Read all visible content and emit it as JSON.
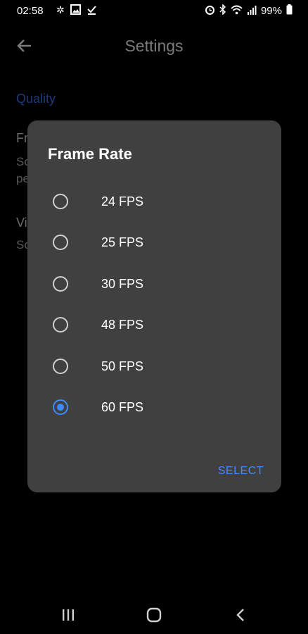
{
  "status_bar": {
    "time": "02:58",
    "left_icons": [
      "pinwheel-icon",
      "image-icon",
      "download-done-icon"
    ],
    "right_icons": [
      "alarm-icon",
      "bluetooth-icon",
      "wifi-icon",
      "signal-icon"
    ],
    "battery": "99%"
  },
  "app_bar": {
    "title": "Settings",
    "back_icon": "arrow-left-icon"
  },
  "background": {
    "section_header": "Quality",
    "item1_title": "Fr",
    "item1_sub_line1": "So",
    "item1_sub_line2": "pe",
    "item2_title": "Vi",
    "item2_sub": "So"
  },
  "dialog": {
    "title": "Frame Rate",
    "options": [
      {
        "label": "24 FPS",
        "selected": false
      },
      {
        "label": "25 FPS",
        "selected": false
      },
      {
        "label": "30 FPS",
        "selected": false
      },
      {
        "label": "48 FPS",
        "selected": false
      },
      {
        "label": "50 FPS",
        "selected": false
      },
      {
        "label": "60 FPS",
        "selected": true
      }
    ],
    "select_label": "SELECT"
  },
  "nav_bar": {
    "icons": [
      "recents-icon",
      "home-icon",
      "back-chevron-icon"
    ]
  },
  "colors": {
    "accent": "#3d8bff",
    "dialog_bg": "#404040",
    "screen_bg": "#000000"
  }
}
